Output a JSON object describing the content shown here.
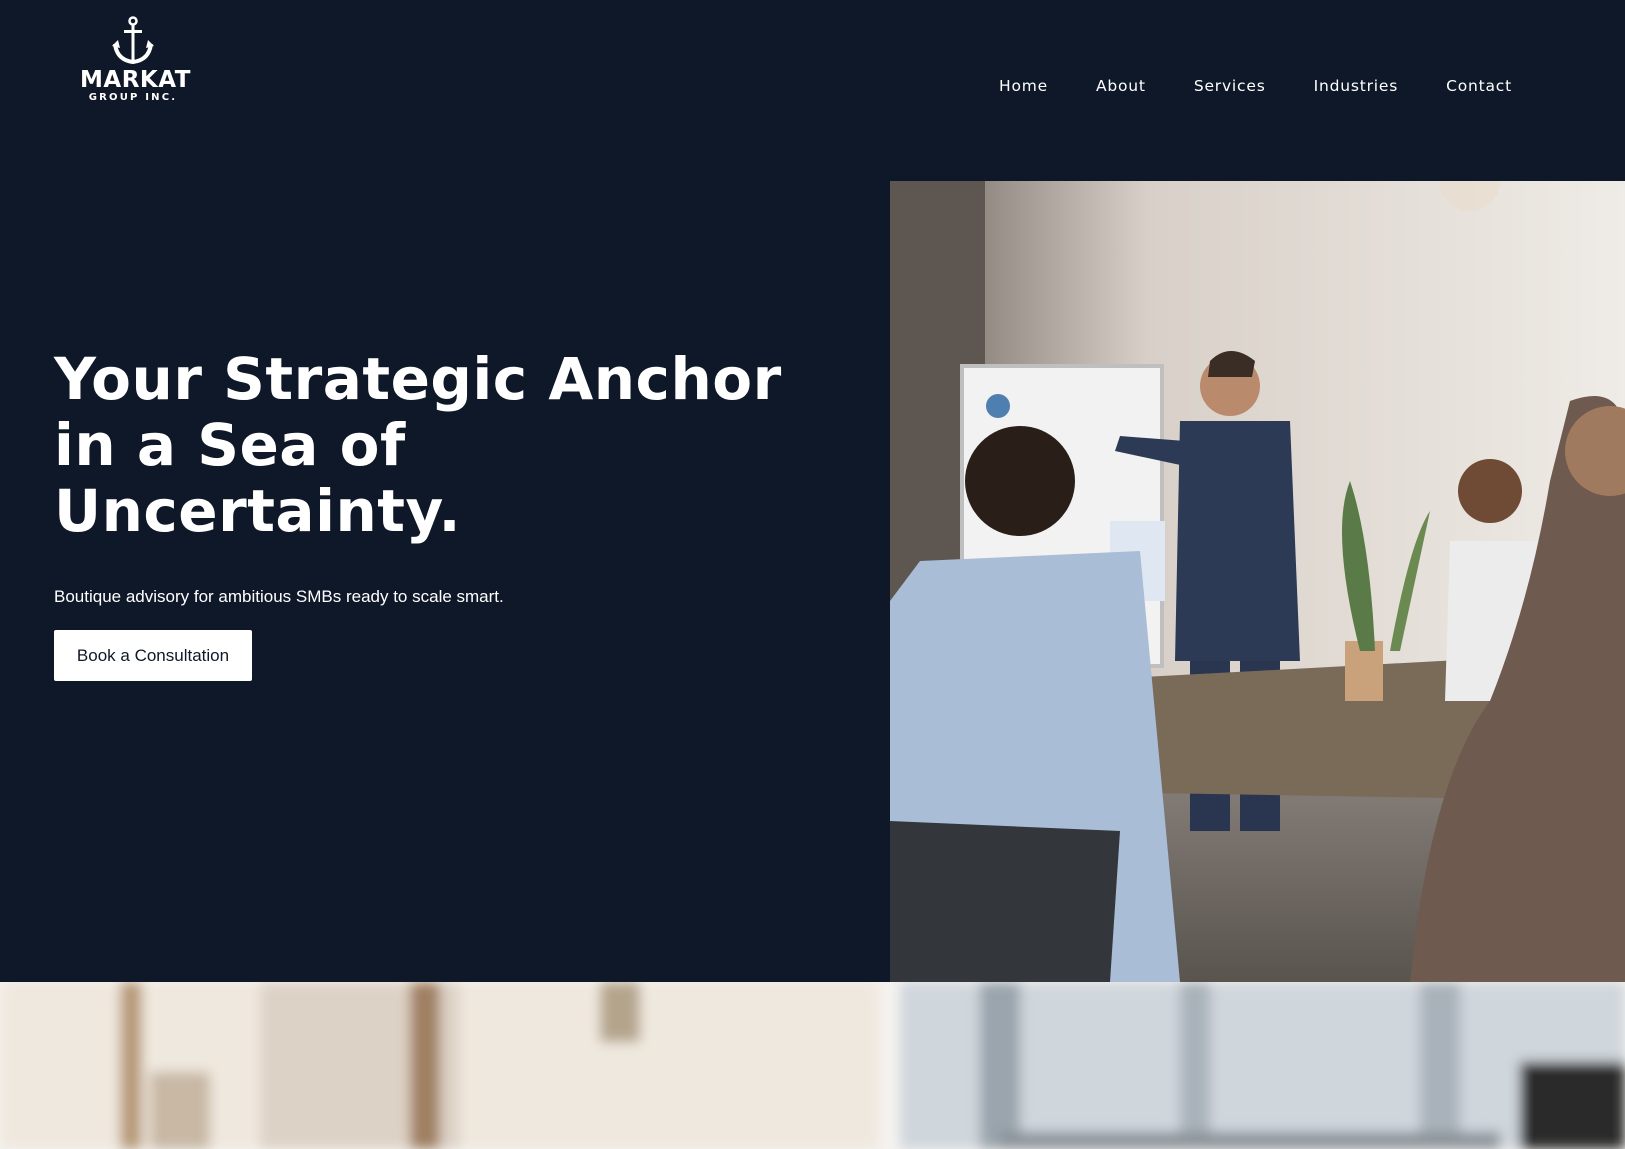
{
  "brand": {
    "name": "MARKAT",
    "sub": "GROUP INC.",
    "logo_icon": "anchor-icon"
  },
  "nav": {
    "items": [
      {
        "label": "Home"
      },
      {
        "label": "About"
      },
      {
        "label": "Services"
      },
      {
        "label": "Industries"
      },
      {
        "label": "Contact"
      }
    ]
  },
  "hero": {
    "headline_line1": "Your Strategic Anchor",
    "headline_line2": "in a Sea of",
    "headline_line3": "Uncertainty.",
    "subtitle": "Boutique advisory for ambitious SMBs ready to scale smart.",
    "cta_label": "Book a Consultation",
    "image_subject": "business meeting presentation"
  },
  "colors": {
    "background": "#0e1828",
    "text": "#ffffff",
    "button_bg": "#ffffff",
    "button_text": "#0e1828"
  }
}
